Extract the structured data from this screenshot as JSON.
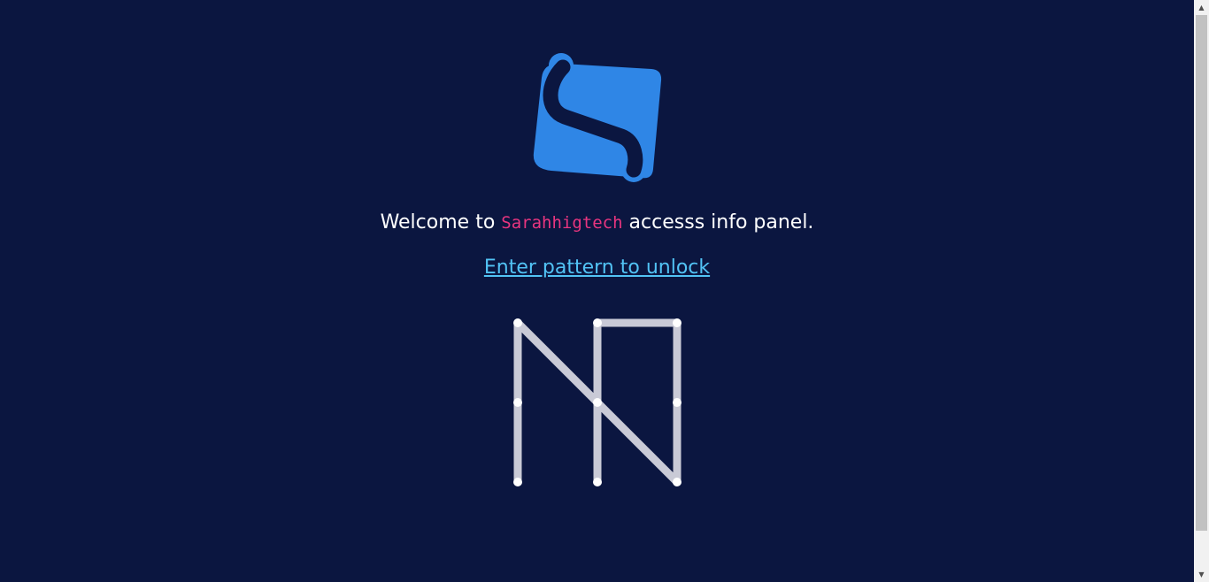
{
  "welcome": {
    "prefix": "Welcome to ",
    "brand": "Sarahhigtech",
    "suffix": " accesss info panel."
  },
  "unlock_link": "Enter pattern to unlock",
  "colors": {
    "background": "#0b1640",
    "logo": "#2f86e6",
    "brand_text": "#e8357f",
    "link": "#52c3f5",
    "pattern_line": "#c9cad6",
    "pattern_dot": "#ffffff"
  },
  "icons": {
    "logo": "sarahhigtech-logo-icon",
    "scroll_up": "chevron-up-icon",
    "scroll_down": "chevron-down-icon"
  },
  "pattern": {
    "grid": "3x3",
    "sequence": [
      7,
      4,
      1,
      5,
      9,
      6,
      3,
      2,
      5,
      8
    ]
  }
}
